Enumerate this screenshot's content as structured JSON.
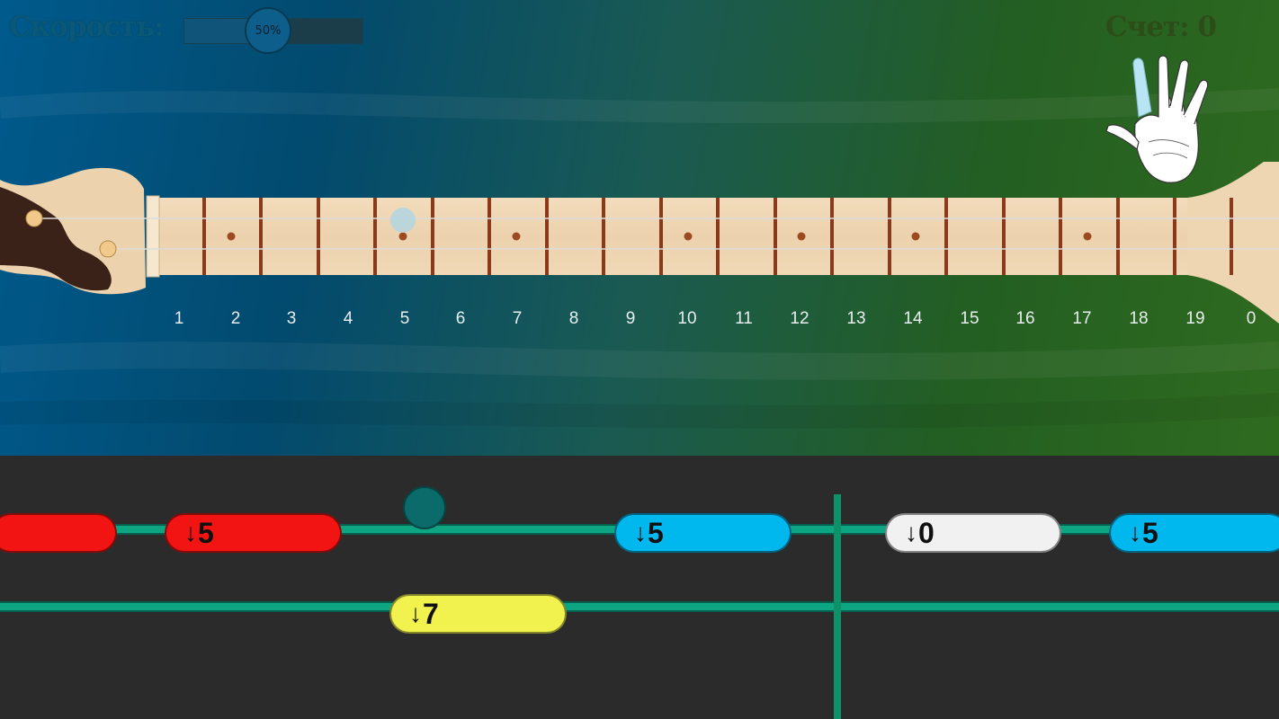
{
  "speed": {
    "label": "Скорость:",
    "value_text": "50%",
    "level": 0.5
  },
  "score": {
    "label": "Счет:",
    "value": "0"
  },
  "hand": {
    "icon": "hand-icon"
  },
  "fretboard": {
    "fret_numbers": [
      "1",
      "2",
      "3",
      "4",
      "5",
      "6",
      "7",
      "8",
      "9",
      "10",
      "11",
      "12",
      "13",
      "14",
      "15",
      "16",
      "17",
      "18",
      "19",
      "0"
    ]
  },
  "lanes": {
    "lane1_notes": [
      {
        "arrow": "↓",
        "value": "",
        "color": "red"
      },
      {
        "arrow": "↓",
        "value": "5",
        "color": "red"
      },
      {
        "arrow": "↓",
        "value": "5",
        "color": "blue"
      },
      {
        "arrow": "↓",
        "value": "0",
        "color": "white"
      },
      {
        "arrow": "↓",
        "value": "5",
        "color": "blue"
      }
    ],
    "lane2_notes": [
      {
        "arrow": "↓",
        "value": "7",
        "color": "yellow"
      }
    ]
  },
  "colors": {
    "red": "#f21313",
    "blue": "#00b7ee",
    "white": "#f1f1f1",
    "yellow": "#f2f24e",
    "lane": "#0ea682"
  }
}
